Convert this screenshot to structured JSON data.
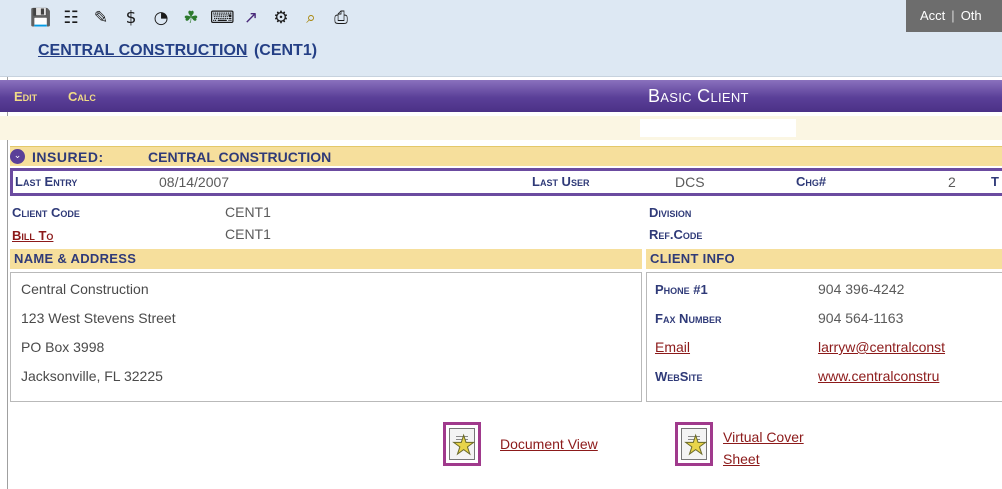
{
  "toolbar": {
    "icons": [
      "save-icon",
      "tree-icon",
      "edit-notes-icon",
      "dollar-icon",
      "clock-icon",
      "network-icon",
      "keyboard-icon",
      "logon-icon",
      "workflow-icon",
      "folder-search-icon",
      "printer-icon"
    ],
    "glyphs": [
      "💾",
      "☷",
      "✎",
      "$",
      "◔",
      "☘",
      "⌨",
      "↗",
      "⚙",
      "⌕",
      "⎙"
    ],
    "acct_label": "Acct",
    "separator": "|",
    "other_label": "Oth"
  },
  "client": {
    "name": "CENTRAL CONSTRUCTION",
    "code": "(CENT1)"
  },
  "menu": {
    "edit_label": "Edit",
    "calc_label": "Calc",
    "title": "Basic Client"
  },
  "insured": {
    "label": "INSURED:",
    "value": "CENTRAL CONSTRUCTION"
  },
  "entry": {
    "last_entry_label": "Last Entry",
    "last_entry_value": "08/14/2007",
    "last_user_label": "Last User",
    "last_user_value": "DCS",
    "chg_label": "Chg#",
    "chg_value": "2",
    "trailing_label": "T"
  },
  "codes": {
    "client_code_label": "Client Code",
    "client_code_value": "CENT1",
    "bill_to_label": "Bill To",
    "bill_to_value": "CENT1",
    "division_label": "Division",
    "ref_code_label": "Ref.Code"
  },
  "address": {
    "header": "NAME & ADDRESS",
    "lines": [
      "Central Construction",
      "123 West Stevens Street",
      "PO Box 3998",
      "Jacksonville, FL  32225"
    ]
  },
  "client_info": {
    "header": "CLIENT INFO",
    "phone_label": "Phone #1",
    "phone_value": "904 396-4242",
    "fax_label": "Fax Number",
    "fax_value": "904 564-1163",
    "email_label": "Email",
    "email_value": "larryw@centralconst",
    "website_label": "WebSite",
    "website_value": "www.centralconstru"
  },
  "documents": {
    "document_view_label": "Document View",
    "virtual_cover_line1": "Virtual Cover",
    "virtual_cover_line2": "Sheet"
  },
  "colors": {
    "menu_purple": "#5a3f98",
    "header_gold": "#f6df9c",
    "label_navy": "#2f3a78",
    "link_red": "#8c1a1a",
    "toolbar_blue": "#dde8f3"
  }
}
